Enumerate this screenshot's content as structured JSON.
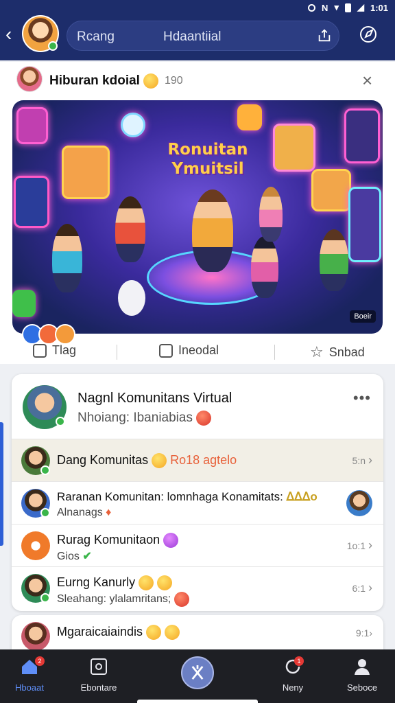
{
  "status_bar": {
    "items": [
      "N",
      "1:01"
    ]
  },
  "header": {
    "search_left": "Rcang",
    "search_right": "Hdaantiial"
  },
  "post": {
    "title": "Hiburan kdoial",
    "count": "190",
    "hero_title": "Ronuitan Ymuitsil",
    "hero_badge": "Boeir",
    "actions": {
      "like": "Tlag",
      "comment": "Ineodal",
      "save": "Snbad"
    }
  },
  "community": {
    "title": "Nagnl Komunitans Virtual",
    "subtitle": "Nhoiang: Ibaniabias",
    "rows": [
      {
        "name": "Dang Komunitas",
        "tag": "Ro18 aɡtelo",
        "meta": "5:n"
      },
      {
        "name": "Raranan Komunitan: lomnhaga Konamitats:",
        "tag": "ᐃᐃᐃo",
        "sub": "Alnanags"
      },
      {
        "name": "Rurag Komunitaon",
        "sub": "Gios",
        "meta": "1o:1"
      },
      {
        "name": "Eurng Kanurly",
        "sub": "Sleahang: ylalamritans;",
        "meta": "6:1"
      }
    ]
  },
  "peek": {
    "name": "Mgaraicaiaindis",
    "meta": "9:1"
  },
  "bottom_nav": [
    {
      "label": "Hboaat",
      "active": true
    },
    {
      "label": "Ebontare",
      "active": false
    },
    {
      "label": "",
      "active": false
    },
    {
      "label": "Neny",
      "active": false
    },
    {
      "label": "Seboce",
      "active": false
    }
  ],
  "colors": {
    "header": "#1d2d6b",
    "accent": "#5f8ef7",
    "nav_bg": "#1e1f24"
  }
}
